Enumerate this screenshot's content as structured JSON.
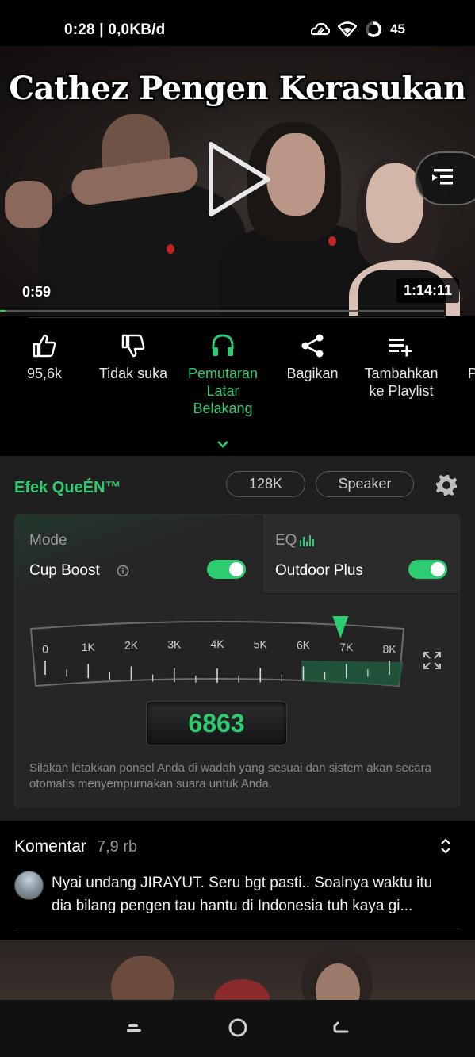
{
  "status_bar": {
    "time_net": "0:28 | 0,0KB/d",
    "battery": "45"
  },
  "video": {
    "title_overlay": "Cathez Pengen Kerasukan",
    "current_time": "0:59",
    "duration": "1:14:11",
    "progress_fraction": 0.013
  },
  "actions": [
    {
      "label": "95,6k",
      "icon": "thumbs-up-icon"
    },
    {
      "label": "Tidak suka",
      "icon": "thumbs-down-icon"
    },
    {
      "label": "Pemutaran Latar Belakang",
      "icon": "headphones-icon"
    },
    {
      "label": "Bagikan",
      "icon": "share-icon"
    },
    {
      "label": "Tambahkan ke Playlist",
      "icon": "playlist-add-icon"
    },
    {
      "label": "P",
      "icon": ""
    }
  ],
  "effects": {
    "title": "Efek QueÉN™",
    "bitrate": "128K",
    "output": "Speaker",
    "mode_label": "Mode",
    "mode_value": "Cup Boost",
    "mode_enabled": true,
    "eq_label": "EQ",
    "eq_value": "Outdoor Plus",
    "eq_enabled": true,
    "dial_ticks": [
      "0",
      "1K",
      "2K",
      "3K",
      "4K",
      "5K",
      "6K",
      "7K",
      "8K"
    ],
    "frequency": "6863",
    "hint": "Silakan letakkan ponsel Anda di wadah yang sesuai dan sistem akan secara otomatis menyempurnakan suara untuk Anda.",
    "accent_color": "#2ecc71"
  },
  "comments": {
    "title": "Komentar",
    "count": "7,9 rb",
    "top_comment": "Nyai undang JIRAYUT. Seru bgt pasti.. Soalnya waktu itu dia bilang pengen tau hantu di Indonesia tuh kaya gi..."
  }
}
